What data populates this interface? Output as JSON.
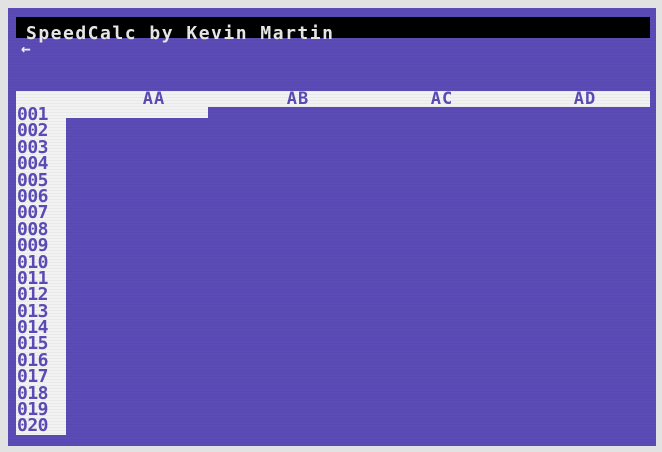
{
  "title": "SpeedCalc by Kevin Martin",
  "prompt_glyph": "←",
  "columns": [
    "AA",
    "AB",
    "AC",
    "AD"
  ],
  "rows": [
    "001",
    "002",
    "003",
    "004",
    "005",
    "006",
    "007",
    "008",
    "009",
    "010",
    "011",
    "012",
    "013",
    "014",
    "015",
    "016",
    "017",
    "018",
    "019",
    "020"
  ],
  "selected_cell": "AA001",
  "colors": {
    "background": "#5b4bb6",
    "foreground": "#f2f2f2",
    "title_bar": "#000000"
  }
}
